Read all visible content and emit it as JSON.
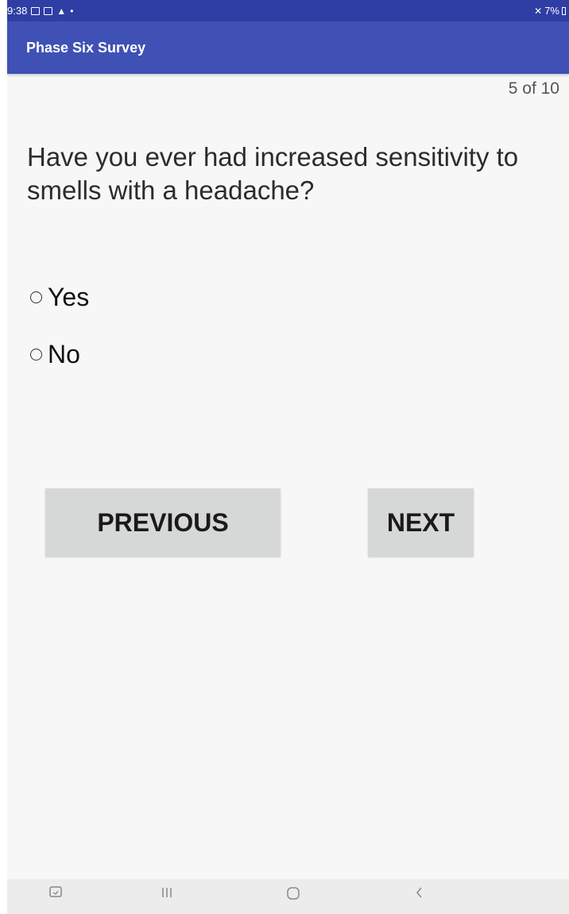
{
  "status_bar": {
    "time": "9:38",
    "battery": "7%",
    "icons_left": [
      "gallery-icon",
      "image-icon",
      "warning-icon",
      "dot-icon"
    ],
    "icons_right": [
      "mute-icon",
      "battery-icon"
    ]
  },
  "app_bar": {
    "title": "Phase Six Survey",
    "color": "#3f51b5"
  },
  "survey": {
    "progress": "5 of 10",
    "question": "Have you ever had increased sensitivity to smells with a headache?",
    "options": [
      {
        "label": "Yes",
        "selected": false
      },
      {
        "label": "No",
        "selected": false
      }
    ]
  },
  "buttons": {
    "previous": "PREVIOUS",
    "next": "NEXT"
  },
  "nav_bar": {
    "items": [
      "screenshot-icon",
      "recents-icon",
      "home-icon",
      "back-icon"
    ]
  }
}
